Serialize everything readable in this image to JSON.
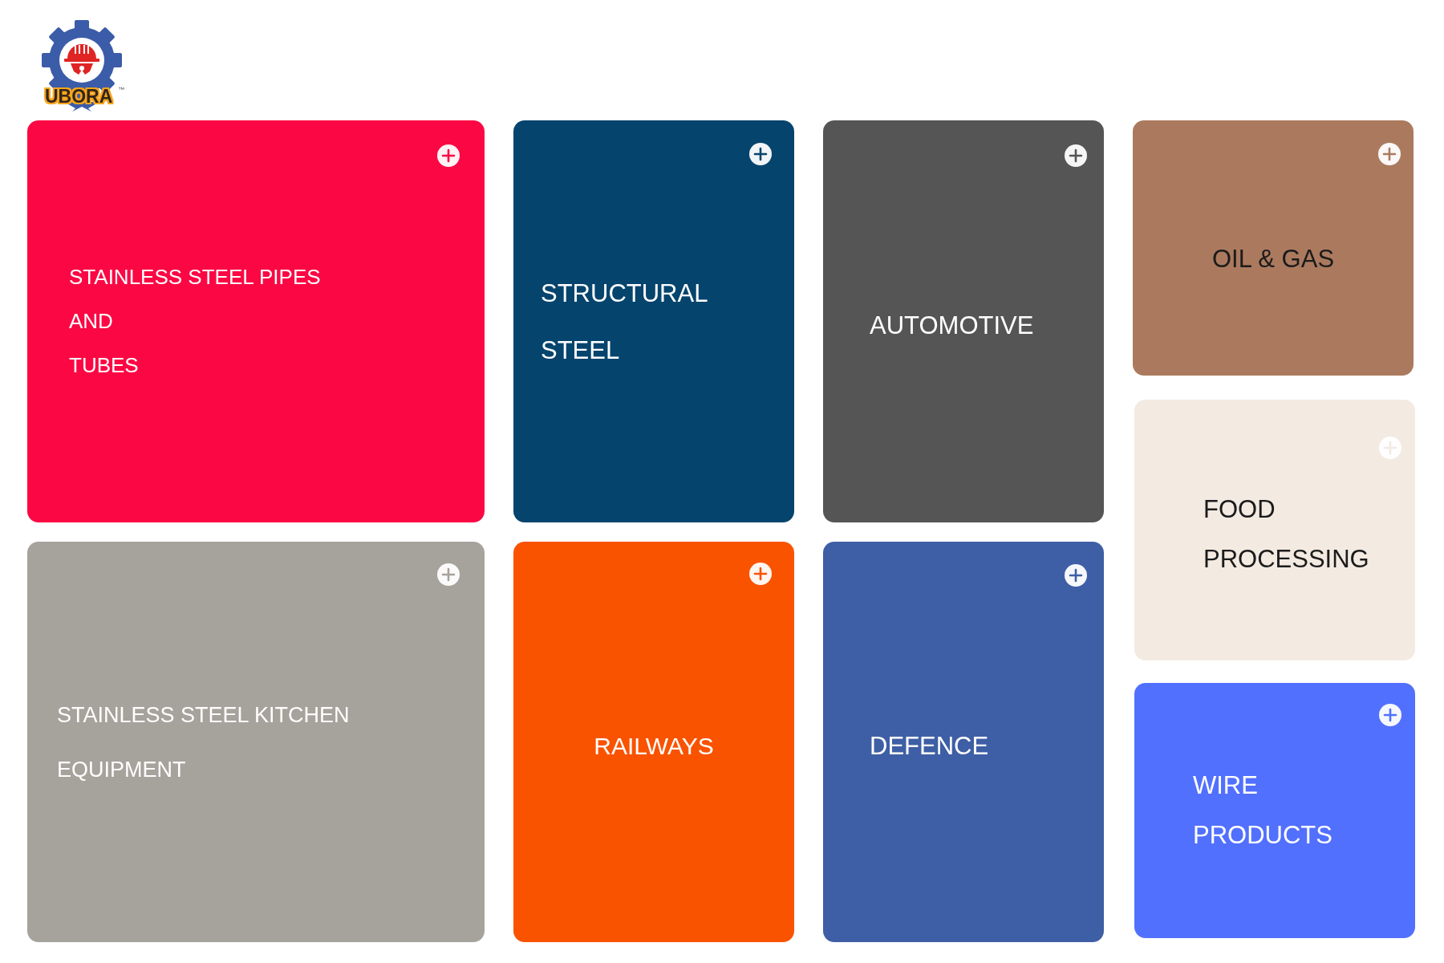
{
  "logo": {
    "name": "UBORA",
    "trademark": "™"
  },
  "tiles": [
    {
      "title": [
        "STAINLESS STEEL PIPES",
        "AND",
        "TUBES"
      ],
      "color": "#fb0844",
      "kind": "light"
    },
    {
      "title": [
        "STRUCTURAL",
        "STEEL"
      ],
      "color": "#05446d",
      "kind": "light"
    },
    {
      "title": [
        "AUTOMOTIVE"
      ],
      "color": "#555555",
      "kind": "light"
    },
    {
      "title": [
        "OIL & GAS"
      ],
      "color": "#ab7a5e",
      "kind": "dark"
    },
    {
      "title": [
        "FOOD",
        "PROCESSING"
      ],
      "color": "#f3eae2",
      "kind": "dark"
    },
    {
      "title": [
        "STAINLESS STEEL KITCHEN",
        "EQUIPMENT"
      ],
      "color": "#a6a29c",
      "kind": "light"
    },
    {
      "title": [
        "RAILWAYS"
      ],
      "color": "#f95300",
      "kind": "light"
    },
    {
      "title": [
        "DEFENCE"
      ],
      "color": "#3e5fa5",
      "kind": "light"
    },
    {
      "title": [
        "WIRE",
        "PRODUCTS"
      ],
      "color": "#5270fe",
      "kind": "light"
    }
  ]
}
